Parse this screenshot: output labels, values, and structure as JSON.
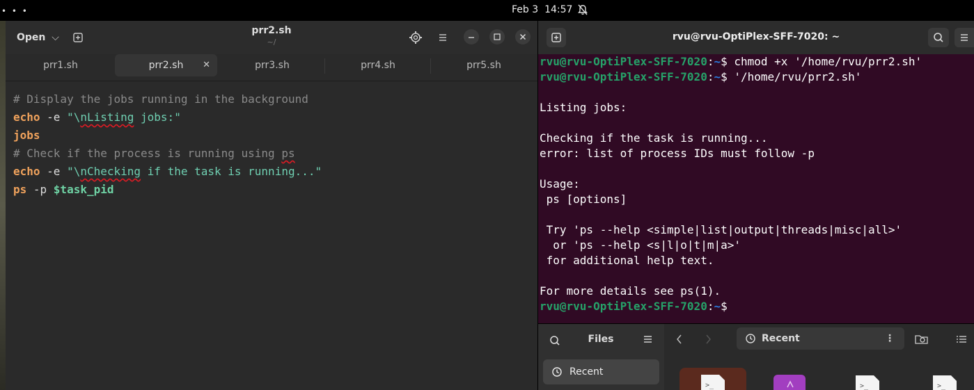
{
  "topbar": {
    "dots": "• • •",
    "date": "Feb 3",
    "time": "14:57"
  },
  "editor": {
    "open_label": "Open",
    "title": "prr2.sh",
    "subtitle": "~/",
    "tabs": [
      {
        "label": "prr1.sh"
      },
      {
        "label": "prr2.sh",
        "active": true
      },
      {
        "label": "prr3.sh"
      },
      {
        "label": "prr4.sh"
      },
      {
        "label": "prr5.sh"
      }
    ],
    "code": {
      "l1_comment": "# Display the jobs running in the background",
      "l2_cmd": "echo",
      "l2_flag": " -e ",
      "l2_q": "\"\\",
      "l2_sp": "nListing",
      "l2_rest": " jobs:\"",
      "l3": "jobs",
      "l4_a": "# Check if the process is running using ",
      "l4_sp": "ps",
      "l5_cmd": "echo",
      "l5_flag": " -e ",
      "l5_q": "\"\\",
      "l5_sp": "nChecking",
      "l5_rest": " if the task is running...\"",
      "l6_cmd": "ps",
      "l6_flag": " -p ",
      "l6_var": "$task_pid"
    }
  },
  "terminal": {
    "title": "rvu@rvu-OptiPlex-SFF-7020: ~",
    "prompt_user": "rvu@rvu-OptiPlex-SFF-7020",
    "prompt_path": "~",
    "cmd1": "chmod +x '/home/rvu/prr2.sh'",
    "cmd2": "'/home/rvu/prr2.sh'",
    "out": [
      "",
      "Listing jobs:",
      "",
      "Checking if the task is running...",
      "error: list of process IDs must follow -p",
      "",
      "Usage:",
      " ps [options]",
      "",
      " Try 'ps --help <simple|list|output|threads|misc|all>'",
      "  or 'ps --help <s|l|o|t|m|a>'",
      " for additional help text.",
      "",
      "For more details see ps(1)."
    ]
  },
  "files": {
    "title": "Files",
    "sidebar_recent": "Recent",
    "path_label": "Recent"
  },
  "colors": {
    "terminal_bg": "#300a24",
    "prompt_user": "#26a269",
    "prompt_path": "#2a7bde",
    "keyword": "#f0a25c",
    "string": "#6fcfb1"
  }
}
